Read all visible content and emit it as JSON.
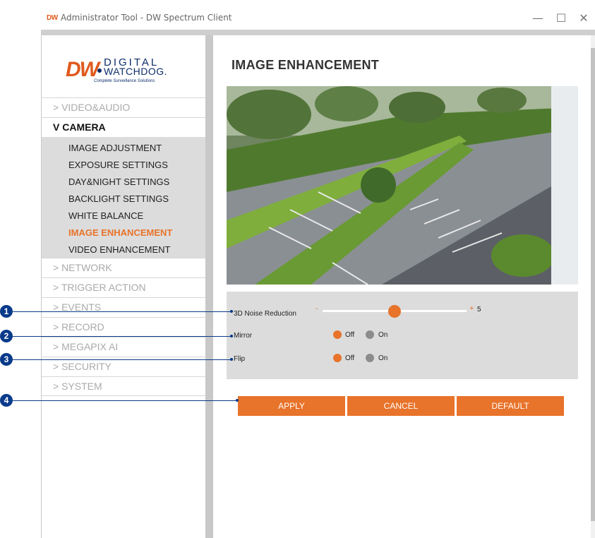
{
  "window": {
    "app_logo": "DW",
    "title": "Administrator Tool - DW Spectrum Client",
    "controls": [
      "—",
      "☐",
      "✕"
    ]
  },
  "brand": {
    "logo_mark": "DW",
    "logo_line1": "DIGITAL",
    "logo_line2": "WATCHDOG.",
    "tagline": "Complete Surveillance Solutions"
  },
  "menu": [
    {
      "label": "> VIDEO&AUDIO"
    },
    {
      "label": "V CAMERA"
    },
    {
      "label": "> NETWORK"
    },
    {
      "label": "> TRIGGER ACTION"
    },
    {
      "label": "> EVENTS"
    },
    {
      "label": "> RECORD"
    },
    {
      "label": "> MEGAPIX AI"
    },
    {
      "label": "> SECURITY"
    },
    {
      "label": "> SYSTEM"
    }
  ],
  "camera_submenu": [
    {
      "label": "IMAGE ADJUSTMENT"
    },
    {
      "label": "EXPOSURE SETTINGS"
    },
    {
      "label": "DAY&NIGHT SETTINGS"
    },
    {
      "label": "BACKLIGHT SETTINGS"
    },
    {
      "label": "WHITE BALANCE"
    },
    {
      "label": "IMAGE ENHANCEMENT"
    },
    {
      "label": "VIDEO ENHANCEMENT"
    }
  ],
  "page": {
    "title": "IMAGE ENHANCEMENT"
  },
  "settings": {
    "noise_reduction": {
      "label": "3D Noise Reduction",
      "minus": "-",
      "plus": "+",
      "value": "5",
      "level_fraction": 0.5
    },
    "mirror": {
      "label": "Mirror",
      "off": "Off",
      "on": "On",
      "selected": "Off"
    },
    "flip": {
      "label": "Flip",
      "off": "Off",
      "on": "On",
      "selected": "Off"
    }
  },
  "buttons": {
    "apply": "APPLY",
    "cancel": "CANCEL",
    "default": "DEFAULT"
  },
  "callouts": [
    "1",
    "2",
    "3",
    "4"
  ],
  "colors": {
    "accent": "#e8732a",
    "callout": "#0a3a8a",
    "brand_orange": "#e05a1e",
    "brand_navy": "#0c2d6b"
  }
}
